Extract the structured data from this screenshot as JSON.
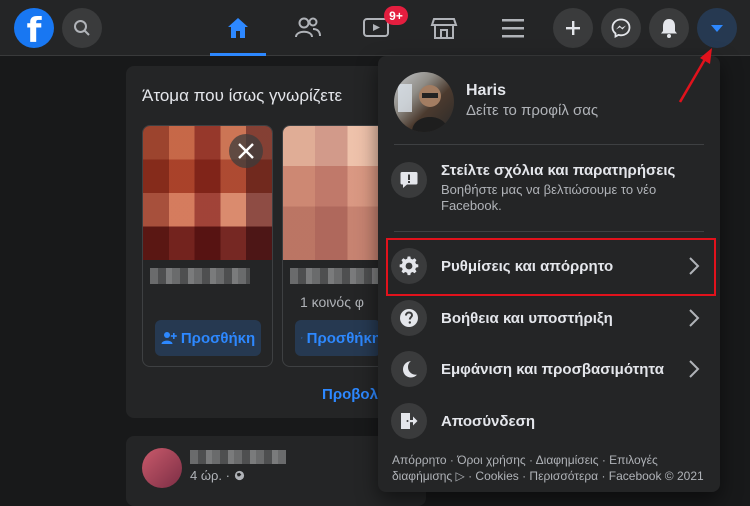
{
  "topbar": {
    "logo_letter": "f",
    "notification_count": "9+"
  },
  "feed": {
    "title": "Άτομα που ίσως γνωρίζετε",
    "add_label": "Προσθήκη",
    "mutual_friends": "1 κοινός φ",
    "view_all": "Προβολ",
    "post_time": "4 ώρ. · "
  },
  "menu": {
    "profile_name": "Haris",
    "profile_sub": "Δείτε το προφίλ σας",
    "feedback_title": "Στείλτε σχόλια και παρατηρήσεις",
    "feedback_sub": "Βοηθήστε μας να βελτιώσουμε το νέο Facebook.",
    "settings": "Ρυθμίσεις και απόρρητο",
    "help": "Βοήθεια και υποστήριξη",
    "display": "Εμφάνιση και προσβασιμότητα",
    "logout": "Αποσύνδεση",
    "footer": "Απόρρητο · Όροι χρήσης · Διαφημίσεις · Επιλογές διαφήμισης ▷ · Cookies · Περισσότερα · Facebook © 2021"
  },
  "colors": {
    "background": "#18191a",
    "surface": "#242526",
    "accent": "#2d88ff",
    "highlight": "#e1121c"
  }
}
